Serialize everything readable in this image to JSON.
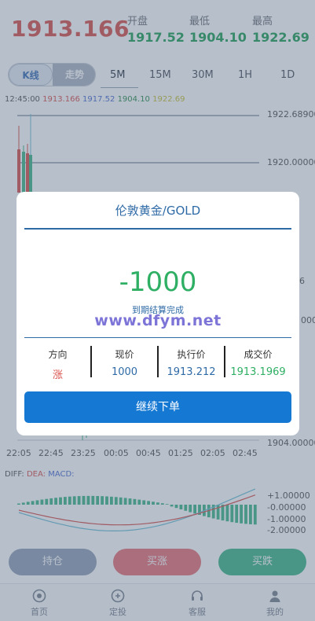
{
  "header": {
    "current_price": "1913.166",
    "stats": [
      {
        "label": "开盘",
        "value": "1917.52"
      },
      {
        "label": "最低",
        "value": "1904.10"
      },
      {
        "label": "最高",
        "value": "1922.69"
      }
    ]
  },
  "tabs": {
    "chart_modes": [
      "K线",
      "走势"
    ],
    "timeframes": [
      "5M",
      "15M",
      "30M",
      "1H",
      "1D"
    ],
    "active_timeframe": "5M"
  },
  "legend": {
    "time": "12:45:00",
    "values": [
      {
        "text": "1913.166",
        "color": "#d9534f"
      },
      {
        "text": "1917.52",
        "color": "#4f6fd1"
      },
      {
        "text": "1904.10",
        "color": "#2f8f4e"
      },
      {
        "text": "1922.69",
        "color": "#c8c23a"
      }
    ]
  },
  "chart": {
    "y_labels": [
      "1922.68900",
      "1920.00000",
      "6",
      "1904.00000"
    ],
    "y_labels_partial": [
      "000"
    ],
    "x_labels": [
      "22:05",
      "22:45",
      "23:25",
      "00:05",
      "00:45",
      "01:25",
      "02:05",
      "02:45"
    ],
    "colors": {
      "up": "#d9534f",
      "down": "#43b98a",
      "wick": "#6fc1d6",
      "line": "#5a6b82"
    }
  },
  "macd": {
    "legend": [
      {
        "text": "DIFF:",
        "color": "#555555"
      },
      {
        "text": "DEA:",
        "color": "#d9534f"
      },
      {
        "text": "MACD:",
        "color": "#4f6fd1"
      }
    ],
    "y_labels": [
      "+1.00000",
      "-0.00000",
      "-1.00000",
      "-2.00000"
    ],
    "bar_color": "#43b98a"
  },
  "actions": {
    "hold": "持仓",
    "buy_up": "买涨",
    "buy_down": "买跌"
  },
  "tabbar": {
    "items": [
      "首页",
      "定投",
      "客服",
      "我的"
    ]
  },
  "modal": {
    "title": "伦敦黄金/GOLD",
    "amount": "-1000",
    "status": "到期结算完成",
    "watermark": "www.dfym.net",
    "columns": [
      {
        "header": "方向",
        "value": "涨",
        "color": "#d9534f"
      },
      {
        "header": "现价",
        "value": "1000",
        "color": "#2e6aa6"
      },
      {
        "header": "执行价",
        "value": "1913.212",
        "color": "#2e6aa6"
      },
      {
        "header": "成交价",
        "value": "1913.1969",
        "color": "#2eaf64"
      }
    ],
    "continue_label": "继续下单"
  }
}
